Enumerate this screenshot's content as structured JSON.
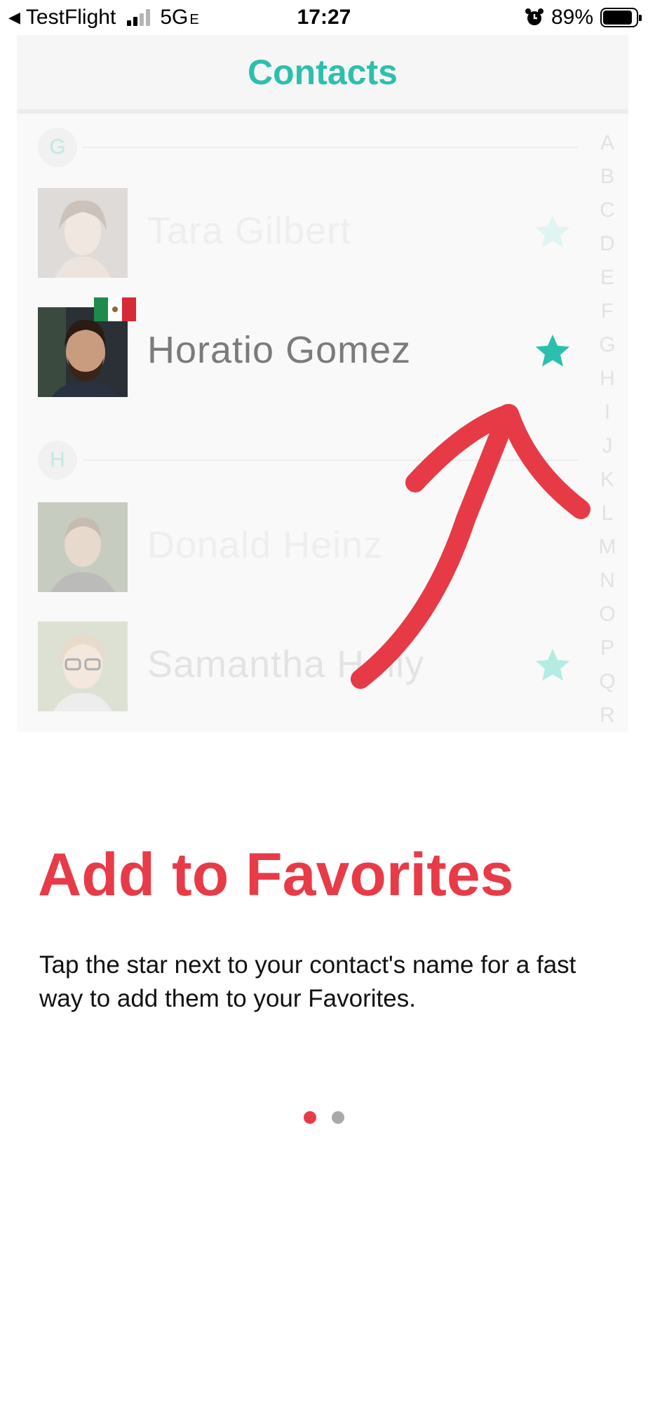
{
  "status_bar": {
    "back_label": "TestFlight",
    "network": "5G",
    "network_suffix": "E",
    "time": "17:27",
    "battery": "89%",
    "battery_level": 0.89,
    "signal_bars_active": 2,
    "signal_bars_total": 4,
    "icons": [
      "back-arrow-icon",
      "signal-icon",
      "alarm-icon",
      "battery-icon"
    ]
  },
  "preview": {
    "title": "Contacts",
    "accent_color": "#2dbfae",
    "sections": [
      {
        "letter": "G",
        "contacts": [
          {
            "name": "Tara Gilbert",
            "favorite": true,
            "highlighted": false
          },
          {
            "name": "Horatio Gomez",
            "favorite": true,
            "highlighted": true,
            "flag": "mexico-flag-icon"
          }
        ]
      },
      {
        "letter": "H",
        "contacts": [
          {
            "name": "Donald Heinz",
            "favorite": false,
            "highlighted": false
          },
          {
            "name": "Samantha Holly",
            "favorite": true,
            "highlighted": false
          }
        ]
      }
    ],
    "index_letters": [
      "A",
      "B",
      "C",
      "D",
      "E",
      "F",
      "G",
      "H",
      "I",
      "J",
      "K",
      "L",
      "M",
      "N",
      "O",
      "P",
      "Q",
      "R"
    ],
    "annotation": "red-arrow-icon"
  },
  "onboarding": {
    "headline": "Add to Favorites",
    "headline_color": "#e83b48",
    "description": "Tap the star next to your contact's name for a fast way to add them to your Favorites.",
    "page_count": 2,
    "current_page": 1
  }
}
